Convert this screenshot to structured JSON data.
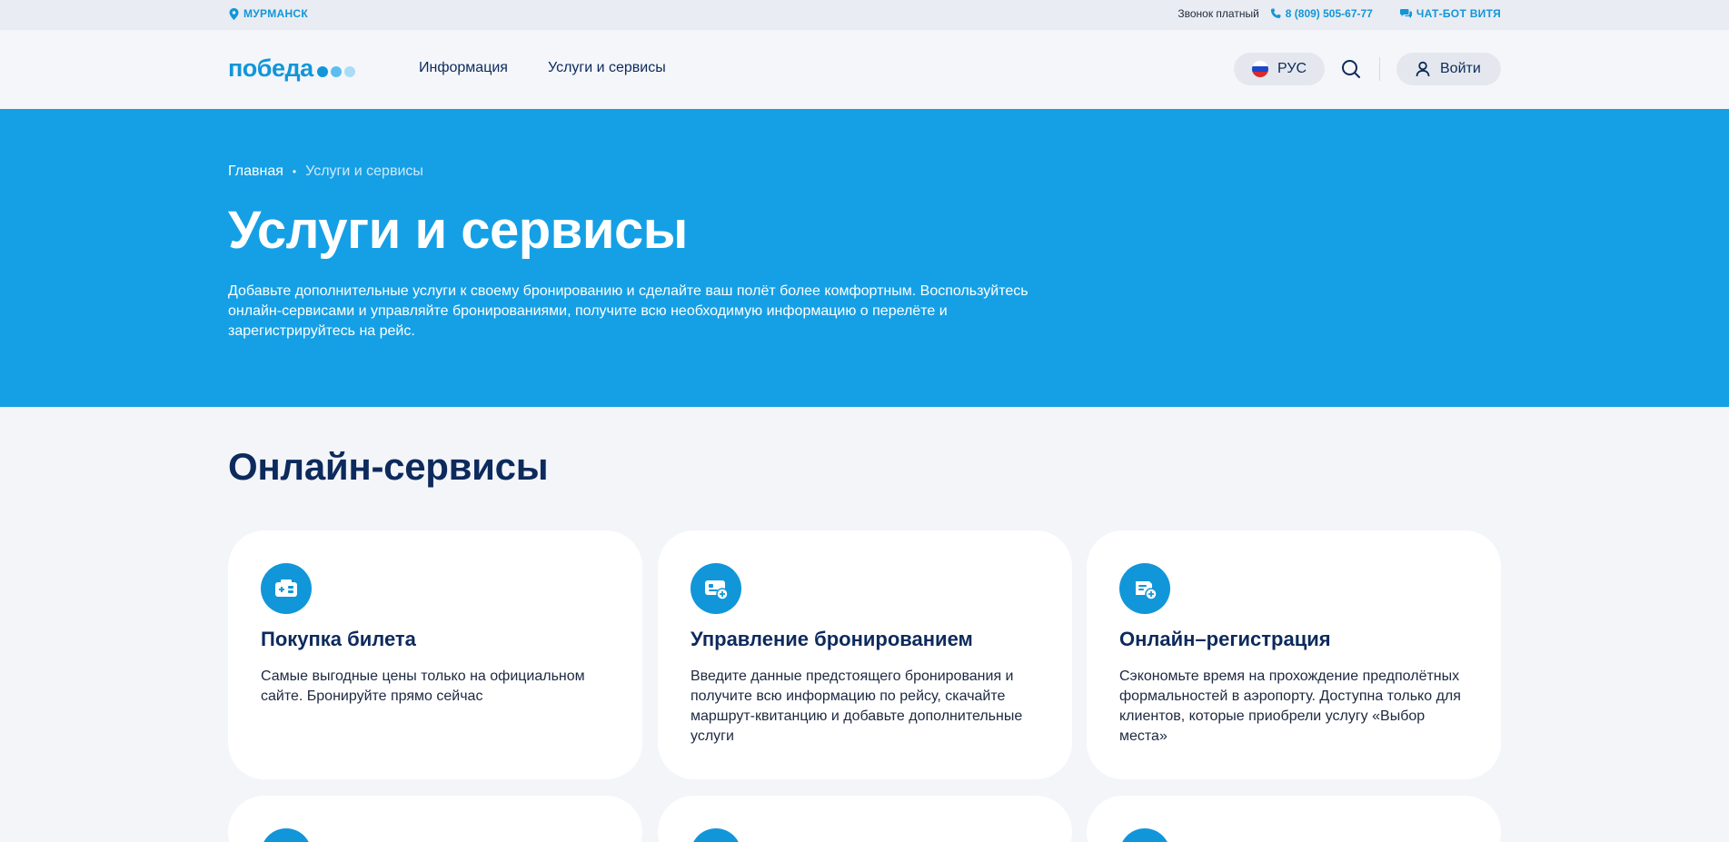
{
  "topbar": {
    "city": "МУРМАНСК",
    "call_note": "Звонок платный",
    "phone": "8 (809) 505-67-77",
    "chatbot": "ЧАТ-БОТ ВИТЯ"
  },
  "header": {
    "logo": "победа",
    "nav": [
      "Информация",
      "Услуги и сервисы"
    ],
    "lang": "РУС",
    "login": "Войти"
  },
  "hero": {
    "breadcrumb": [
      "Главная",
      "Услуги и сервисы"
    ],
    "title": "Услуги и сервисы",
    "description": "Добавьте дополнительные услуги к своему бронированию и сделайте ваш полёт более комфортным. Воспользуйтесь онлайн-сервисами и управляйте бронированиями, получите всю необходимую информацию о перелёте и зарегистрируйтесь на рейс."
  },
  "online_services": {
    "title": "Онлайн-сервисы",
    "cards": [
      {
        "icon": "ticket-icon",
        "title": "Покупка билета",
        "text": "Самые выгодные цены только на официальном сайте. Бронируйте прямо сейчас"
      },
      {
        "icon": "booking-manage-icon",
        "title": "Управление бронированием",
        "text": "Введите данные предстоящего бронирования и получите всю информацию по рейсу, скачайте маршрут-квитанцию и добавьте дополнительные услуги"
      },
      {
        "icon": "checkin-icon",
        "title": "Онлайн–регистрация",
        "text": "Сэкономьте время на прохождение предполётных формальностей в аэропорту. Доступна только для клиентов, которые приобрели услугу «Выбор места»"
      }
    ]
  },
  "colors": {
    "brand_blue": "#1196d9",
    "hero_blue": "#15a0e6",
    "navy": "#0d2a5c",
    "page_bg": "#f3f5f9"
  }
}
